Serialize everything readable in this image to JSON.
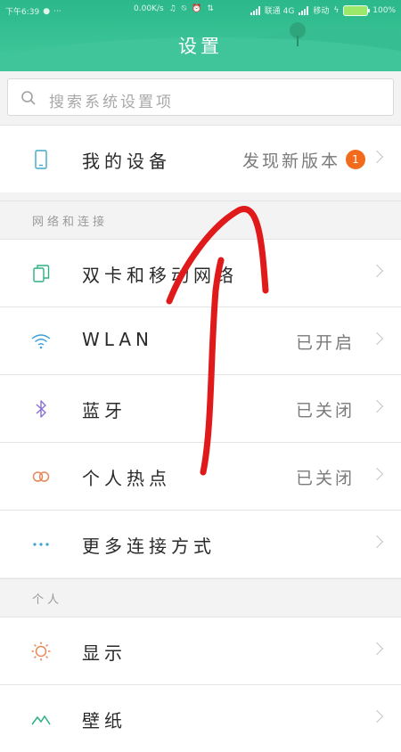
{
  "statusbar": {
    "time": "下午6:39",
    "network": "0.00K/s",
    "carrier": "联通 4G",
    "carrier2": "移动",
    "battery_pct": "100%"
  },
  "header": {
    "title": "设置"
  },
  "search": {
    "placeholder": "搜索系统设置项"
  },
  "device_row": {
    "label": "我的设备",
    "value": "发现新版本",
    "badge": "1"
  },
  "sections": [
    {
      "title": "网络和连接",
      "items": [
        {
          "label": "双卡和移动网络",
          "value": "",
          "icon": "dual-sim-icon"
        },
        {
          "label": "WLAN",
          "value": "已开启",
          "icon": "wifi-icon"
        },
        {
          "label": "蓝牙",
          "value": "已关闭",
          "icon": "bluetooth-icon"
        },
        {
          "label": "个人热点",
          "value": "已关闭",
          "icon": "hotspot-icon"
        },
        {
          "label": "更多连接方式",
          "value": "",
          "icon": "more-dots-icon"
        }
      ]
    },
    {
      "title": "个人",
      "items": [
        {
          "label": "显示",
          "value": "",
          "icon": "display-sun-icon"
        },
        {
          "label": "壁纸",
          "value": "",
          "icon": "wallpaper-icon"
        }
      ]
    }
  ],
  "colors": {
    "header_green": "#2bb88a",
    "badge_orange": "#f26b1d",
    "annotation_red": "#e0191b"
  }
}
